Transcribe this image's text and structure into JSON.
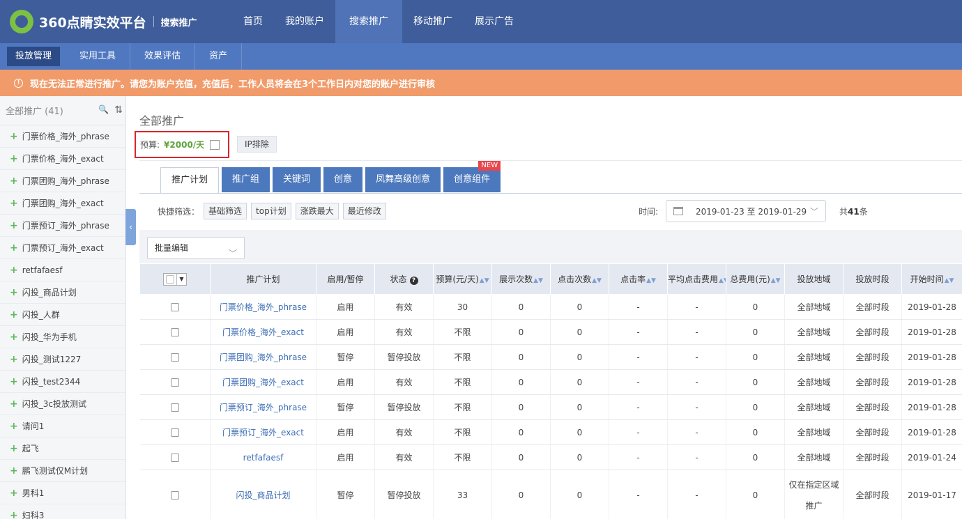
{
  "header": {
    "logo_text": "360点睛实效平台",
    "logo_sub": "搜索推广",
    "nav": [
      {
        "label": "首页"
      },
      {
        "label": "我的账户"
      },
      {
        "label": "搜索推广"
      },
      {
        "label": "移动推广"
      },
      {
        "label": "展示广告"
      }
    ]
  },
  "subnav": [
    {
      "label": "投放管理"
    },
    {
      "label": "实用工具"
    },
    {
      "label": "效果评估"
    },
    {
      "label": "资产"
    }
  ],
  "alert": {
    "icon": "!",
    "text": "现在无法正常进行推广。请您为账户充值，充值后，工作人员将会在3个工作日内对您的账户进行审核"
  },
  "sidebar": {
    "title": "全部推广 (41)",
    "search_icon": "🔍",
    "sort_icon": "⇅",
    "items": [
      {
        "label": "门票价格_海外_phrase"
      },
      {
        "label": "门票价格_海外_exact"
      },
      {
        "label": "门票团购_海外_phrase"
      },
      {
        "label": "门票团购_海外_exact"
      },
      {
        "label": "门票预订_海外_phrase"
      },
      {
        "label": "门票预订_海外_exact"
      },
      {
        "label": "retfafaesf"
      },
      {
        "label": "闪投_商品计划"
      },
      {
        "label": "闪投_人群"
      },
      {
        "label": "闪投_华为手机"
      },
      {
        "label": "闪投_测试1227"
      },
      {
        "label": "闪投_test2344"
      },
      {
        "label": "闪投_3c投放测试"
      },
      {
        "label": "请问1"
      },
      {
        "label": "起飞"
      },
      {
        "label": "鹏飞测试仅M计划"
      },
      {
        "label": "男科1"
      },
      {
        "label": "妇科3"
      }
    ]
  },
  "main": {
    "title": "全部推广",
    "budget_label": "预算:",
    "budget_value": "¥2000/天",
    "ip_button": "IP排除",
    "tabs": [
      {
        "label": "推广计划"
      },
      {
        "label": "推广组"
      },
      {
        "label": "关键词"
      },
      {
        "label": "创意"
      },
      {
        "label": "凤舞高级创意"
      },
      {
        "label": "创意组件"
      }
    ],
    "new_badge": "NEW",
    "filter_label": "快捷筛选：",
    "filters": [
      {
        "label": "基础筛选"
      },
      {
        "label": "top计划"
      },
      {
        "label": "涨跌最大"
      },
      {
        "label": "最近修改"
      }
    ],
    "time_label": "时间:",
    "date_range": "2019-01-23 至 2019-01-29",
    "total_prefix": "共",
    "total_count": "41",
    "total_suffix": "条",
    "batch_edit": "批量编辑"
  },
  "table": {
    "headers": [
      "推广计划",
      "启用/暂停",
      "状态",
      "预算(元/天)",
      "展示次数",
      "点击次数",
      "点击率",
      "平均点击费用",
      "总费用(元)",
      "投放地域",
      "投放时段",
      "开始时间"
    ],
    "rows": [
      [
        "门票价格_海外_phrase",
        "启用",
        "有效",
        "30",
        "0",
        "0",
        "-",
        "-",
        "0",
        "全部地域",
        "全部时段",
        "2019-01-28"
      ],
      [
        "门票价格_海外_exact",
        "启用",
        "有效",
        "不限",
        "0",
        "0",
        "-",
        "-",
        "0",
        "全部地域",
        "全部时段",
        "2019-01-28"
      ],
      [
        "门票团购_海外_phrase",
        "暂停",
        "暂停投放",
        "不限",
        "0",
        "0",
        "-",
        "-",
        "0",
        "全部地域",
        "全部时段",
        "2019-01-28"
      ],
      [
        "门票团购_海外_exact",
        "启用",
        "有效",
        "不限",
        "0",
        "0",
        "-",
        "-",
        "0",
        "全部地域",
        "全部时段",
        "2019-01-28"
      ],
      [
        "门票预订_海外_phrase",
        "暂停",
        "暂停投放",
        "不限",
        "0",
        "0",
        "-",
        "-",
        "0",
        "全部地域",
        "全部时段",
        "2019-01-28"
      ],
      [
        "门票预订_海外_exact",
        "启用",
        "有效",
        "不限",
        "0",
        "0",
        "-",
        "-",
        "0",
        "全部地域",
        "全部时段",
        "2019-01-28"
      ],
      [
        "retfafaesf",
        "启用",
        "有效",
        "不限",
        "0",
        "0",
        "-",
        "-",
        "0",
        "全部地域",
        "全部时段",
        "2019-01-24"
      ],
      [
        "闪投_商品计划",
        "暂停",
        "暂停投放",
        "33",
        "0",
        "0",
        "-",
        "-",
        "0",
        "仅在指定区域推广",
        "全部时段",
        "2019-01-17"
      ]
    ]
  }
}
